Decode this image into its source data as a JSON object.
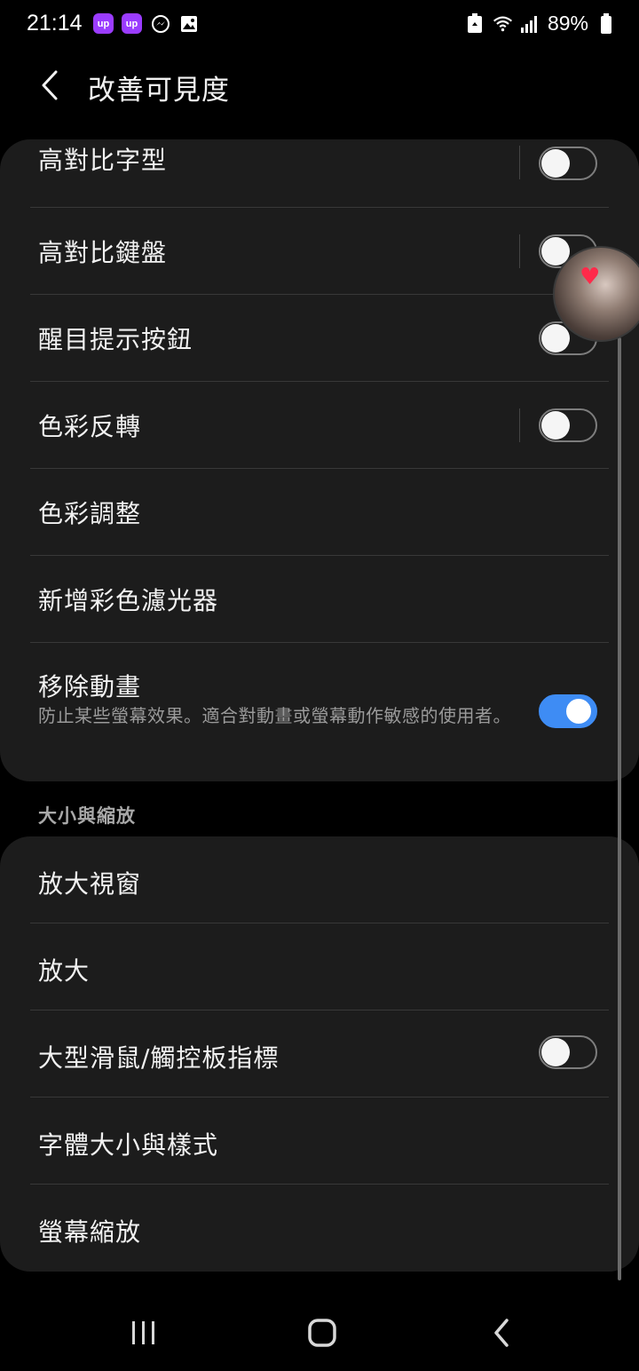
{
  "status_bar": {
    "time": "21:14",
    "app_badge_1": "up",
    "app_badge_2": "up",
    "battery_percent": "89%",
    "icons": [
      "up-app-icon",
      "up-app-icon",
      "messenger-icon",
      "gallery-icon",
      "recycle-icon",
      "wifi-icon",
      "signal-icon",
      "battery-icon"
    ]
  },
  "header": {
    "title": "改善可見度",
    "back_icon": "chevron-left-icon"
  },
  "visibility_section": {
    "items": [
      {
        "label": "高對比字型",
        "switch": "off"
      },
      {
        "label": "高對比鍵盤",
        "switch": "off"
      },
      {
        "label": "醒目提示按鈕",
        "switch": "off"
      },
      {
        "label": "色彩反轉",
        "switch": "off"
      },
      {
        "label": "色彩調整"
      },
      {
        "label": "新增彩色濾光器"
      },
      {
        "label": "移除動畫",
        "description": "防止某些螢幕效果。適合對動畫或螢幕動作敏感的使用者。",
        "switch": "on"
      }
    ]
  },
  "size_section": {
    "header": "大小與縮放",
    "items": [
      {
        "label": "放大視窗"
      },
      {
        "label": "放大"
      },
      {
        "label": "大型滑鼠/觸控板指標",
        "switch": "off"
      },
      {
        "label": "字體大小與樣式"
      },
      {
        "label": "螢幕縮放"
      }
    ]
  },
  "colors": {
    "background": "#000000",
    "card": "#1c1c1c",
    "accent": "#3e8cf4"
  },
  "nav_bar": {
    "icons": [
      "recent-apps-icon",
      "home-icon",
      "back-icon"
    ]
  }
}
